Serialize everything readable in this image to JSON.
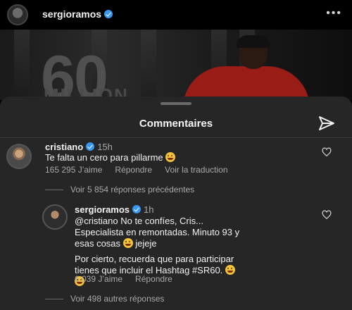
{
  "post": {
    "username": "sergioramos",
    "more_label": "•••",
    "image_big_text": "60",
    "image_sub_text": "MILLION"
  },
  "sheet": {
    "title": "Commentaires"
  },
  "comments": [
    {
      "username": "cristiano",
      "time": "15h",
      "text": "Te falta un cero para pillarme",
      "likes": "165 295 J’aime",
      "reply": "Répondre",
      "translate": "Voir la traduction",
      "view_previous": "Voir 5 854 réponses précédentes"
    },
    {
      "username": "sergioramos",
      "time": "1h",
      "text_lines": [
        "@cristiano No te confíes, Cris...",
        "Especialista en remontadas. Minuto 93 y",
        "esas cosas",
        "jejeje",
        "Por cierto, recuerda que para participar",
        "tienes que incluir el Hashtag #SR60."
      ],
      "likes": "6 039 J’aime",
      "reply": "Répondre",
      "view_more": "Voir 498 autres réponses"
    }
  ],
  "icons": {
    "verified": "verified-badge-icon",
    "send": "paper-plane-icon",
    "heart": "heart-outline-icon",
    "emoji": "laughing-face-emoji"
  },
  "colors": {
    "background": "#000000",
    "sheet": "#262626",
    "verified": "#3897f0",
    "muted_text": "#a8a8a8"
  }
}
